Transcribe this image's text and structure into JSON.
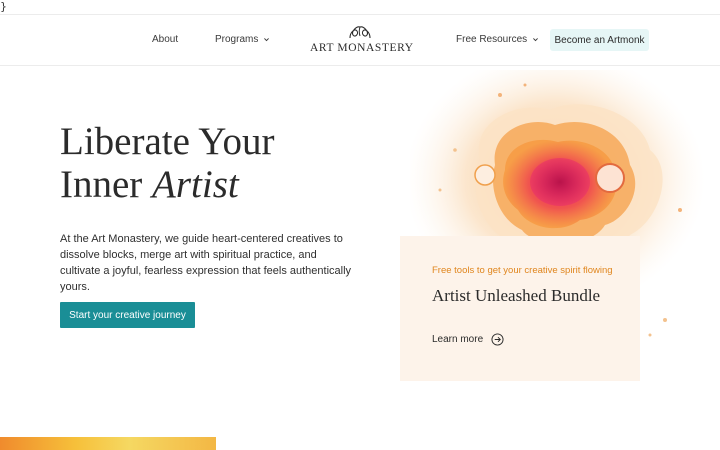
{
  "stray_text": "}",
  "header": {
    "nav_about": "About",
    "nav_programs": "Programs",
    "logo_text": "ART MONASTERY",
    "nav_free_resources": "Free Resources",
    "cta_label": "Become an Artmonk"
  },
  "hero": {
    "title_line1": "Liberate Your",
    "title_line2_plain": "Inner ",
    "title_line2_italic": "Artist",
    "description": "At the Art Monastery, we guide heart-centered creatives to dissolve blocks, merge art with spiritual practice, and cultivate a joyful, fearless expression that feels authentically yours.",
    "button_label": "Start your creative journey"
  },
  "card": {
    "eyebrow": "Free tools to get your creative spirit flowing",
    "title": "Artist Unleashed Bundle",
    "link_label": "Learn more"
  },
  "colors": {
    "accent_teal": "#1a8e96",
    "cta_bg": "#e6f6f6",
    "card_bg": "#fdf3ea",
    "eyebrow_orange": "#e0861e"
  },
  "icons": [
    "chevron-down-icon",
    "art-monastery-logo-icon",
    "arrow-circle-right-icon"
  ]
}
